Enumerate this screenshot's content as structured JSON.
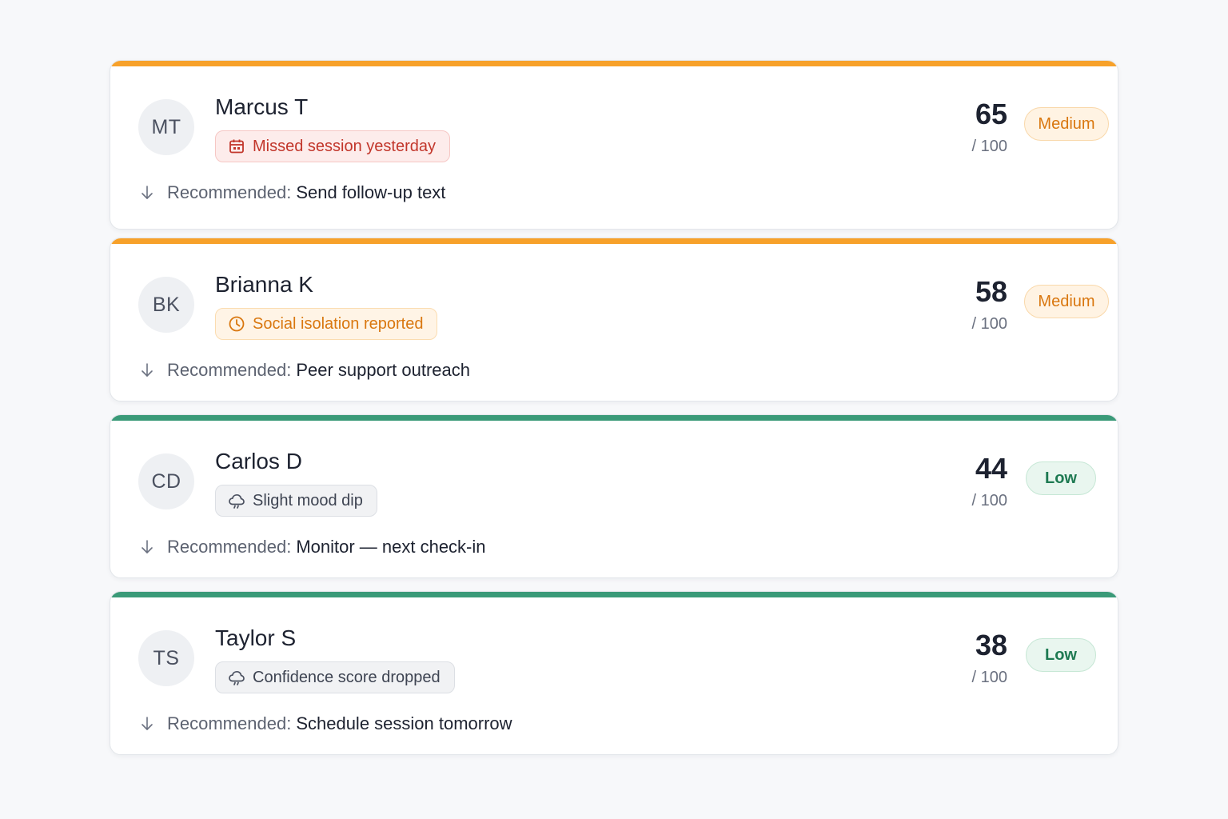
{
  "colors": {
    "medium_accent": "#f7a12a",
    "low_accent": "#3a9a78"
  },
  "rec_prefix": "Recommended:",
  "score_suffix": "/ 100",
  "students": [
    {
      "initials": "MT",
      "name": "Marcus T",
      "flag": "Missed session yesterday",
      "flag_icon": "calendar-icon",
      "flag_tone": "red",
      "score": "65",
      "level": "Medium",
      "accent": "#f7a12a",
      "recommendation": "Send follow-up text"
    },
    {
      "initials": "BK",
      "name": "Brianna K",
      "flag": "Social isolation reported",
      "flag_icon": "clock-icon",
      "flag_tone": "orange",
      "score": "58",
      "level": "Medium",
      "accent": "#f7a12a",
      "recommendation": "Peer support outreach"
    },
    {
      "initials": "CD",
      "name": "Carlos D",
      "flag": "Slight mood dip",
      "flag_icon": "cloud-icon",
      "flag_tone": "gray",
      "score": "44",
      "level": "Low",
      "accent": "#3a9a78",
      "recommendation": "Monitor — next check-in"
    },
    {
      "initials": "TS",
      "name": "Taylor S",
      "flag": "Confidence score dropped",
      "flag_icon": "cloud-icon",
      "flag_tone": "gray",
      "score": "38",
      "level": "Low",
      "accent": "#3a9a78",
      "recommendation": "Schedule session tomorrow"
    }
  ]
}
